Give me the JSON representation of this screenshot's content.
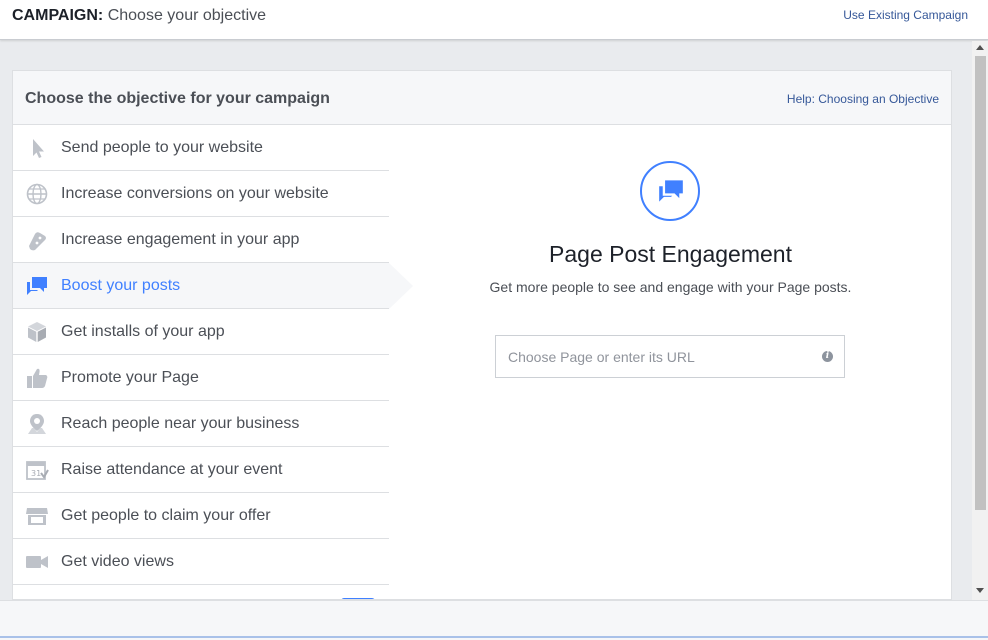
{
  "header": {
    "title_bold": "CAMPAIGN:",
    "title_rest": "Choose your objective",
    "existing_link": "Use Existing Campaign"
  },
  "panel": {
    "heading": "Choose the objective for your campaign",
    "help_link": "Help: Choosing an Objective"
  },
  "objectives": [
    {
      "label": "Send people to your website",
      "icon": "cursor-icon"
    },
    {
      "label": "Increase conversions on your website",
      "icon": "globe-icon"
    },
    {
      "label": "Increase engagement in your app",
      "icon": "gamepad-icon"
    },
    {
      "label": "Boost your posts",
      "icon": "chat-bubbles-icon",
      "selected": true
    },
    {
      "label": "Get installs of your app",
      "icon": "box-icon"
    },
    {
      "label": "Promote your Page",
      "icon": "thumbs-up-icon"
    },
    {
      "label": "Reach people near your business",
      "icon": "map-pin-icon"
    },
    {
      "label": "Raise attendance at your event",
      "icon": "calendar-icon"
    },
    {
      "label": "Get people to claim your offer",
      "icon": "storefront-icon"
    },
    {
      "label": "Get video views",
      "icon": "video-camera-icon"
    }
  ],
  "detail": {
    "icon": "chat-bubbles-icon",
    "title": "Page Post Engagement",
    "description": "Get more people to see and engage with your Page posts.",
    "input_placeholder": "Choose Page or enter its URL",
    "info_glyph": "i"
  },
  "colors": {
    "accent": "#4080ff",
    "link": "#365899",
    "text": "#4b4f56",
    "icon_gray": "#bec2c9"
  }
}
